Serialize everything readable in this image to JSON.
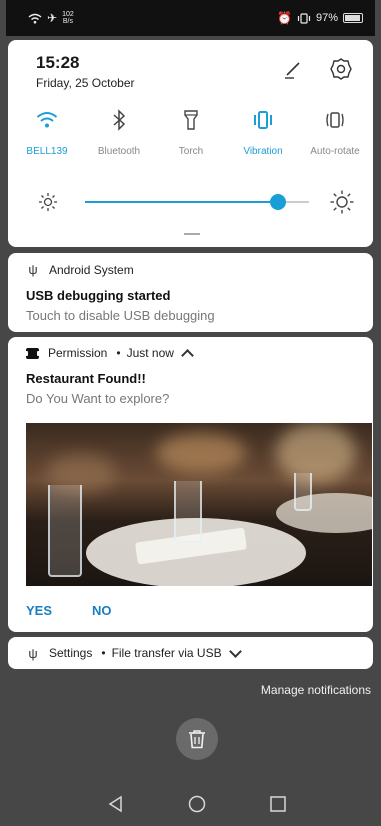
{
  "status_bar": {
    "net_speed_value": "102",
    "net_speed_unit": "B/s",
    "battery_percent": "97%",
    "icons": [
      "wifi-icon",
      "airplane-icon",
      "alarm-icon",
      "vibrate-icon",
      "battery-icon"
    ]
  },
  "quick_settings": {
    "time": "15:28",
    "date": "Friday, 25 October",
    "toggles": [
      {
        "label": "BELL139",
        "icon": "wifi-icon",
        "active": true
      },
      {
        "label": "Bluetooth",
        "icon": "bluetooth-icon",
        "active": false
      },
      {
        "label": "Torch",
        "icon": "torch-icon",
        "active": false
      },
      {
        "label": "Vibration",
        "icon": "vibrate-icon",
        "active": true
      },
      {
        "label": "Auto-rotate",
        "icon": "rotate-icon",
        "active": false
      }
    ],
    "brightness_fraction": 0.86,
    "accent_color": "#1a9ed8"
  },
  "notifications": {
    "android_system": {
      "app": "Android System",
      "title": "USB debugging started",
      "text": "Touch to disable USB debugging"
    },
    "permission": {
      "app": "Permission",
      "separator": "•",
      "time": "Just now",
      "title": "Restaurant Found!!",
      "text": "Do You Want to explore?",
      "actions": [
        "YES",
        "NO"
      ],
      "action_color": "#1a7fc2"
    },
    "settings": {
      "app": "Settings",
      "separator": "•",
      "summary": "File transfer via USB"
    }
  },
  "manage_label": "Manage notifications",
  "nav": {
    "back": "back-icon",
    "home": "home-icon",
    "recents": "recents-icon"
  }
}
